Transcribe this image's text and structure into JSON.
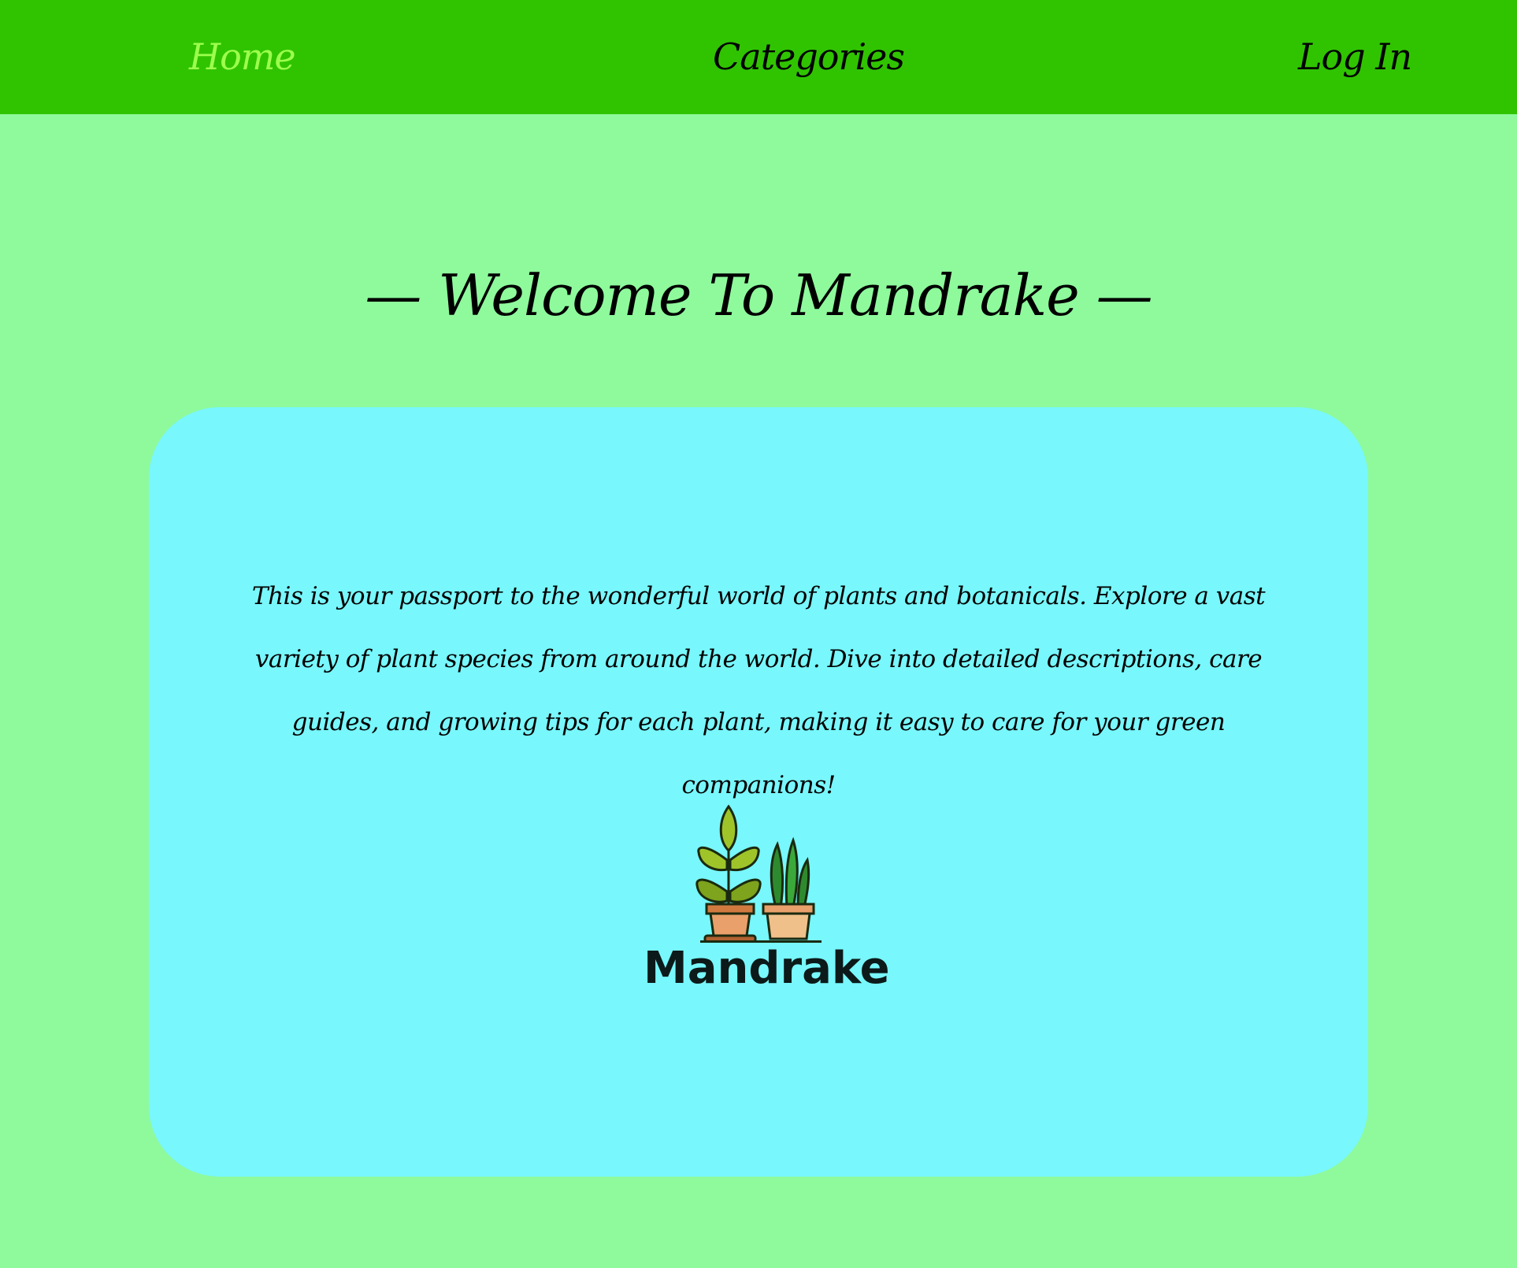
{
  "nav": {
    "home": "Home",
    "categories": "Categories",
    "login": "Log In"
  },
  "header": {
    "title": "— Welcome To Mandrake —"
  },
  "main": {
    "intro": "This is your passport to the wonderful world of plants and botanicals. Explore a vast variety of plant species from around the world. Dive into detailed descriptions, care guides, and growing tips for each plant, making it easy to care for your green companions!",
    "logo": {
      "icon": "potted-plants-icon",
      "text": "Mandrake"
    }
  },
  "colors": {
    "background": "#8efa9c",
    "navbar": "#30c400",
    "nav_active": "#9dff4e",
    "card": "#78f7fc"
  }
}
